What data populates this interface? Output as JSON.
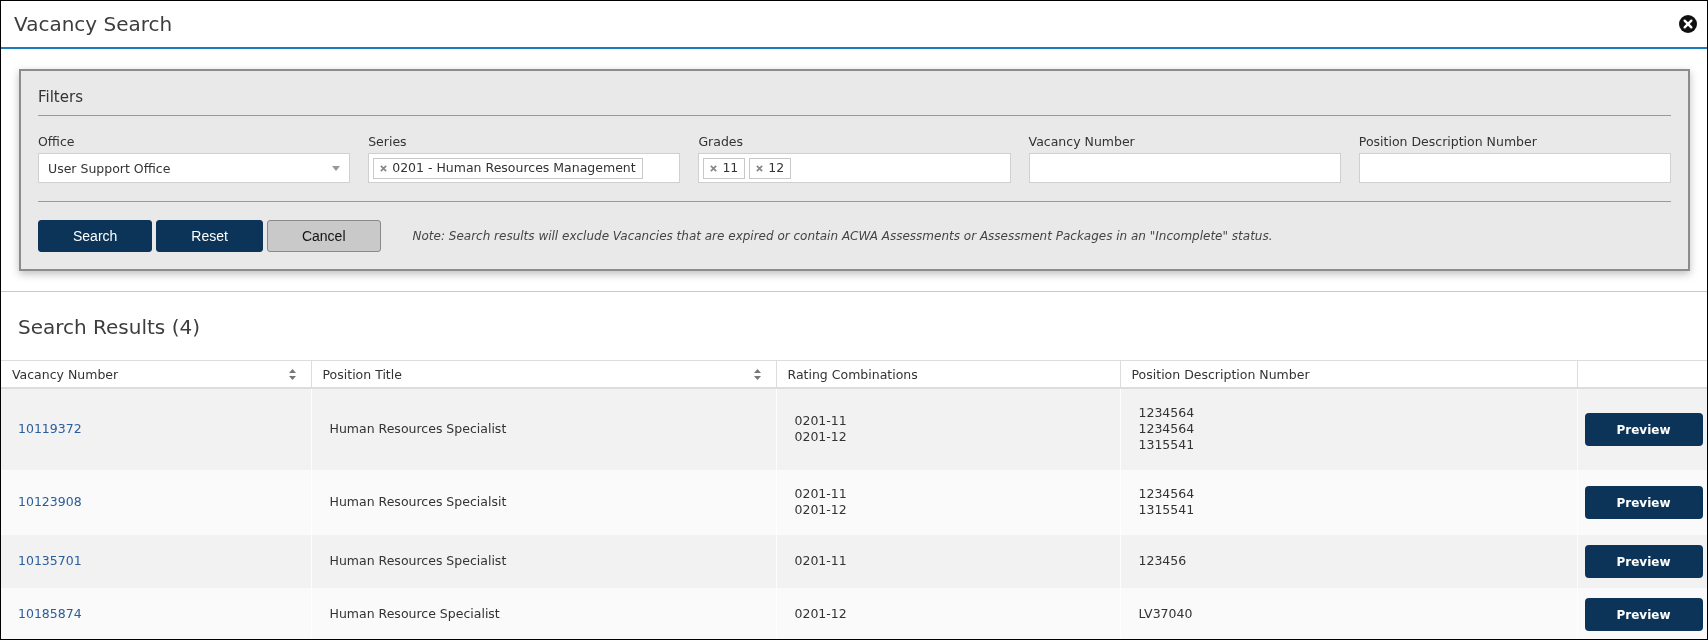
{
  "window": {
    "title": "Vacancy Search"
  },
  "filters": {
    "title": "Filters",
    "fields": [
      {
        "kind": "select",
        "label": "Office",
        "value": "User Support Office"
      },
      {
        "kind": "tags",
        "label": "Series",
        "tags": [
          "0201 - Human Resources Management"
        ]
      },
      {
        "kind": "tags",
        "label": "Grades",
        "tags": [
          "11",
          "12"
        ]
      },
      {
        "kind": "text",
        "label": "Vacancy Number"
      },
      {
        "kind": "text",
        "label": "Position Description Number"
      }
    ],
    "buttons": [
      {
        "label": "Search",
        "kind": "primary"
      },
      {
        "label": "Reset",
        "kind": "primary"
      },
      {
        "label": "Cancel",
        "kind": "secondary"
      }
    ],
    "note": "Note: Search results will exclude Vacancies that are expired or contain ACWA Assessments or Assessment Packages in an \"Incomplete\" status."
  },
  "results": {
    "title": "Search Results (4)",
    "columns": [
      {
        "label": "Vacancy Number",
        "sortable": true
      },
      {
        "label": "Position Title",
        "sortable": true
      },
      {
        "label": "Rating Combinations",
        "sortable": false
      },
      {
        "label": "Position Description Number",
        "sortable": false
      }
    ],
    "rows": [
      {
        "vacancy_number": "10119372",
        "position_title": "Human Resources Specialist",
        "rating_combinations": [
          "0201-11",
          "0201-12"
        ],
        "position_description_numbers": [
          "1234564",
          "1234564",
          "1315541"
        ],
        "action": "Preview"
      },
      {
        "vacancy_number": "10123908",
        "position_title": "Human Resources Specialsit",
        "rating_combinations": [
          "0201-11",
          "0201-12"
        ],
        "position_description_numbers": [
          "1234564",
          "1315541"
        ],
        "action": "Preview"
      },
      {
        "vacancy_number": "10135701",
        "position_title": "Human Resources Specialist",
        "rating_combinations": [
          "0201-11"
        ],
        "position_description_numbers": [
          "123456"
        ],
        "action": "Preview"
      },
      {
        "vacancy_number": "10185874",
        "position_title": "Human Resource Specialist",
        "rating_combinations": [
          "0201-12"
        ],
        "position_description_numbers": [
          "LV37040"
        ],
        "action": "Preview"
      }
    ]
  }
}
